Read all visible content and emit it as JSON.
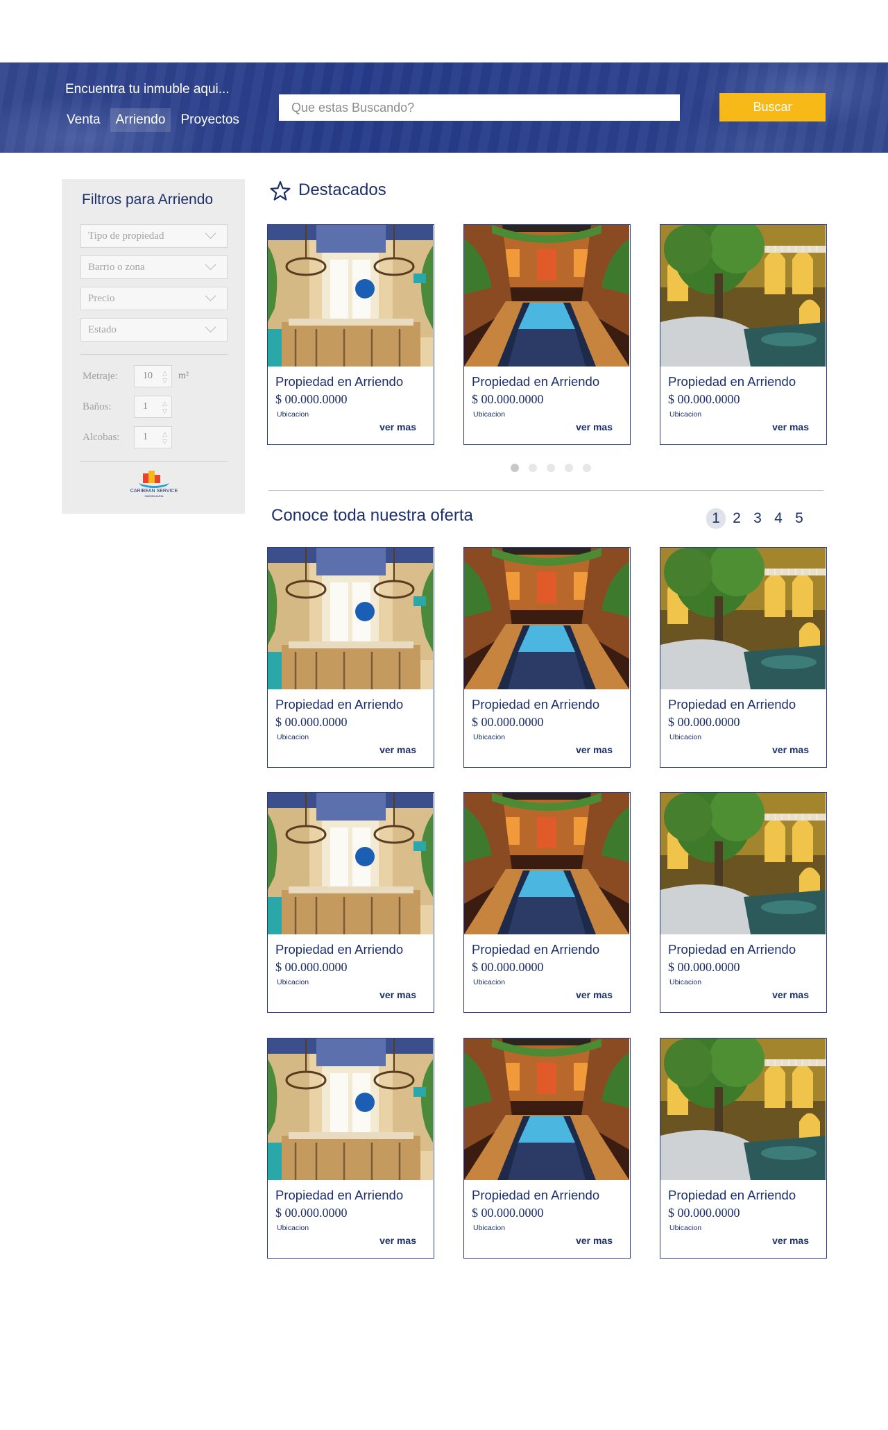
{
  "hero": {
    "tagline": "Encuentra tu inmuble aqui...",
    "tabs": [
      {
        "label": "Venta",
        "active": false
      },
      {
        "label": "Arriendo",
        "active": true
      },
      {
        "label": "Proyectos",
        "active": false
      }
    ],
    "search_placeholder": "Que estas Buscando?",
    "search_button": "Buscar"
  },
  "sidebar": {
    "title": "Filtros para Arriendo",
    "selects": [
      "Tipo de propiedad",
      "Barrio o zona",
      "Precio",
      "Estado"
    ],
    "steppers": [
      {
        "label": "Metraje:",
        "value": "10",
        "unit": "m²"
      },
      {
        "label": "Baños:",
        "value": "1",
        "unit": ""
      },
      {
        "label": "Alcobas:",
        "value": "1",
        "unit": ""
      }
    ],
    "logo_text": "CARIBEAN SERVICE",
    "logo_subtext": "INMOBILIARIA"
  },
  "featured": {
    "title": "Destacados",
    "cards": [
      {
        "title": "Propiedad en Arriendo",
        "price": "$ 00.000.0000",
        "location": "Ubicacion",
        "more": "ver mas",
        "image": "dining-room"
      },
      {
        "title": "Propiedad en Arriendo",
        "price": "$ 00.000.0000",
        "location": "Ubicacion",
        "more": "ver mas",
        "image": "courtyard-pool"
      },
      {
        "title": "Propiedad en Arriendo",
        "price": "$ 00.000.0000",
        "location": "Ubicacion",
        "more": "ver mas",
        "image": "patio-tree"
      }
    ],
    "dots": 5,
    "active_dot": 1
  },
  "offers": {
    "title": "Conoce toda nuestra oferta",
    "pages": [
      "1",
      "2",
      "3",
      "4",
      "5"
    ],
    "active_page": "1",
    "cards": [
      {
        "title": "Propiedad en Arriendo",
        "price": "$ 00.000.0000",
        "location": "Ubicacion",
        "more": "ver mas",
        "image": "dining-room"
      },
      {
        "title": "Propiedad en Arriendo",
        "price": "$ 00.000.0000",
        "location": "Ubicacion",
        "more": "ver mas",
        "image": "courtyard-pool"
      },
      {
        "title": "Propiedad en Arriendo",
        "price": "$ 00.000.0000",
        "location": "Ubicacion",
        "more": "ver mas",
        "image": "patio-tree"
      },
      {
        "title": "Propiedad en Arriendo",
        "price": "$ 00.000.0000",
        "location": "Ubicacion",
        "more": "ver mas",
        "image": "dining-room"
      },
      {
        "title": "Propiedad en Arriendo",
        "price": "$ 00.000.0000",
        "location": "Ubicacion",
        "more": "ver mas",
        "image": "courtyard-pool"
      },
      {
        "title": "Propiedad en Arriendo",
        "price": "$ 00.000.0000",
        "location": "Ubicacion",
        "more": "ver mas",
        "image": "patio-tree"
      },
      {
        "title": "Propiedad en Arriendo",
        "price": "$ 00.000.0000",
        "location": "Ubicacion",
        "more": "ver mas",
        "image": "dining-room"
      },
      {
        "title": "Propiedad en Arriendo",
        "price": "$ 00.000.0000",
        "location": "Ubicacion",
        "more": "ver mas",
        "image": "courtyard-pool"
      },
      {
        "title": "Propiedad en Arriendo",
        "price": "$ 00.000.0000",
        "location": "Ubicacion",
        "more": "ver mas",
        "image": "patio-tree"
      }
    ]
  },
  "colors": {
    "brand_blue": "#1c2f6b",
    "hero_blue": "#263c8a",
    "accent_yellow": "#f7b918",
    "sidebar_gray": "#ececec"
  }
}
